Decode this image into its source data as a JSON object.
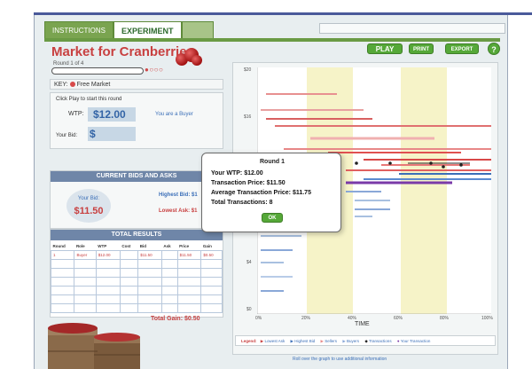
{
  "tabs": [
    {
      "label": "INSTRUCTIONS"
    },
    {
      "label": "EXPERIMENT"
    }
  ],
  "market": {
    "title": "Market for Cranberries",
    "round_label": "Round 1 of 4"
  },
  "toolbar": {
    "play": "PLAY",
    "print": "PRINT",
    "export": "EXPORT",
    "help": "?"
  },
  "key": {
    "prefix": "KEY:",
    "label": "Free Market"
  },
  "round_panel": {
    "hint": "Click Play to start this round",
    "wtp_label": "WTP:",
    "wtp_value": "$12.00",
    "role": "You are a Buyer",
    "bid_label": "Your Bid:",
    "bid_value": "$"
  },
  "bids_asks": {
    "title": "CURRENT BIDS AND ASKS",
    "your_bid_label": "Your Bid:",
    "your_bid_value": "$11.50",
    "highest_bid_label": "Highest Bid: $1",
    "lowest_ask_label": "Lowest Ask: $1"
  },
  "results": {
    "title": "TOTAL RESULTS",
    "columns": [
      "Round",
      "Role",
      "WTP",
      "Cost",
      "Bid",
      "Ask",
      "Price",
      "Gain"
    ],
    "rows": [
      [
        "1",
        "Buyer",
        "$12.00",
        "",
        "$11.50",
        "",
        "$11.50",
        "$0.50"
      ],
      [
        "",
        "",
        "",
        "",
        "",
        "",
        "",
        ""
      ],
      [
        "",
        "",
        "",
        "",
        "",
        "",
        "",
        ""
      ],
      [
        "",
        "",
        "",
        "",
        "",
        "",
        "",
        ""
      ],
      [
        "",
        "",
        "",
        "",
        "",
        "",
        "",
        ""
      ],
      [
        "",
        "",
        "",
        "",
        "",
        "",
        "",
        ""
      ],
      [
        "",
        "",
        "",
        "",
        "",
        "",
        "",
        ""
      ]
    ],
    "total_gain": "Total Gain: $0.50"
  },
  "graph": {
    "y_ticks": [
      "$20",
      "$16",
      "$4",
      "$0"
    ],
    "x_ticks": [
      "0%",
      "20%",
      "40%",
      "60%",
      "80%",
      "100%"
    ],
    "x_title": "TIME",
    "legend_title": "Legend:",
    "legend_items": [
      "Lowest Ask",
      "Highest Bid",
      "Sellers",
      "Buyers",
      "Transactions",
      "Your Transaction"
    ],
    "rollover_hint": "Roll over the graph to use additional information"
  },
  "popup": {
    "title": "Round 1",
    "line1": "Your WTP: $12.00",
    "line2": "Transaction Price: $11.50",
    "line3": "Average Transaction Price: $11.75",
    "line4": "Total Transactions: 8",
    "ok": "OK"
  },
  "colors": {
    "accent_green": "#55a838",
    "title_red": "#c84040",
    "buyer_blue": "#3b6fb8",
    "header_steel": "#6f86a8",
    "band_yellow": "#f6f3c8"
  }
}
